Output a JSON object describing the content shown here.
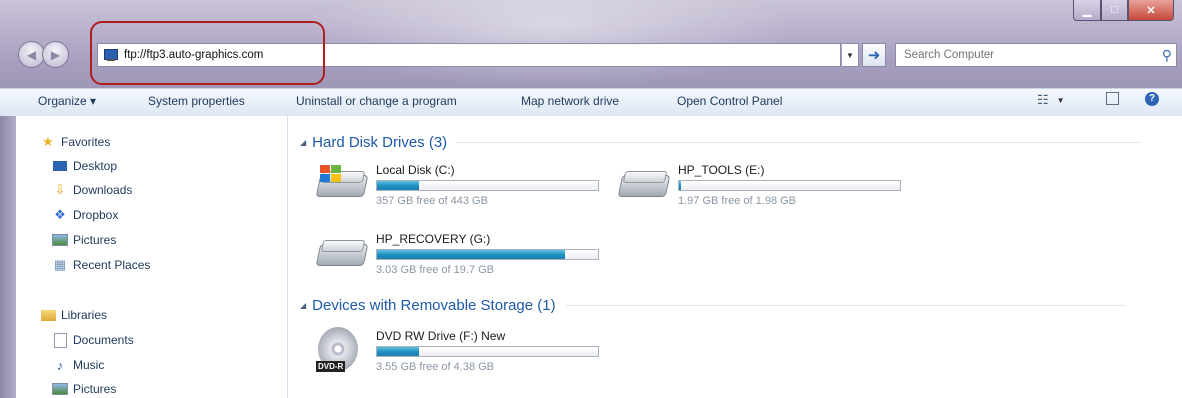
{
  "window": {
    "address": "ftp://ftp3.auto-graphics.com",
    "search_placeholder": "Search Computer"
  },
  "commands": {
    "organize": "Organize ▾",
    "system_properties": "System properties",
    "uninstall": "Uninstall or change a program",
    "map_drive": "Map network drive",
    "control_panel": "Open Control Panel"
  },
  "sidebar": {
    "favorites": "Favorites",
    "desktop": "Desktop",
    "downloads": "Downloads",
    "dropbox": "Dropbox",
    "pictures": "Pictures",
    "recent": "Recent Places",
    "libraries": "Libraries",
    "documents": "Documents",
    "music": "Music",
    "lib_pictures": "Pictures"
  },
  "groups": {
    "hdd": "Hard Disk Drives (3)",
    "removable": "Devices with Removable Storage (1)"
  },
  "drives": [
    {
      "name": "Local Disk (C:)",
      "free": "357 GB free of 443 GB",
      "used_fraction": 0.19
    },
    {
      "name": "HP_TOOLS (E:)",
      "free": "1.97 GB free of 1.98 GB",
      "used_fraction": 0.01
    },
    {
      "name": "HP_RECOVERY (G:)",
      "free": "3.03 GB free of 19.7 GB",
      "used_fraction": 0.85
    },
    {
      "name": "DVD RW Drive (F:) New",
      "free": "3.55 GB free of 4.38 GB",
      "used_fraction": 0.19,
      "badge": "DVD-R"
    }
  ],
  "colors": {
    "accent": "#1e5aa8",
    "highlight": "#b01e1e"
  }
}
